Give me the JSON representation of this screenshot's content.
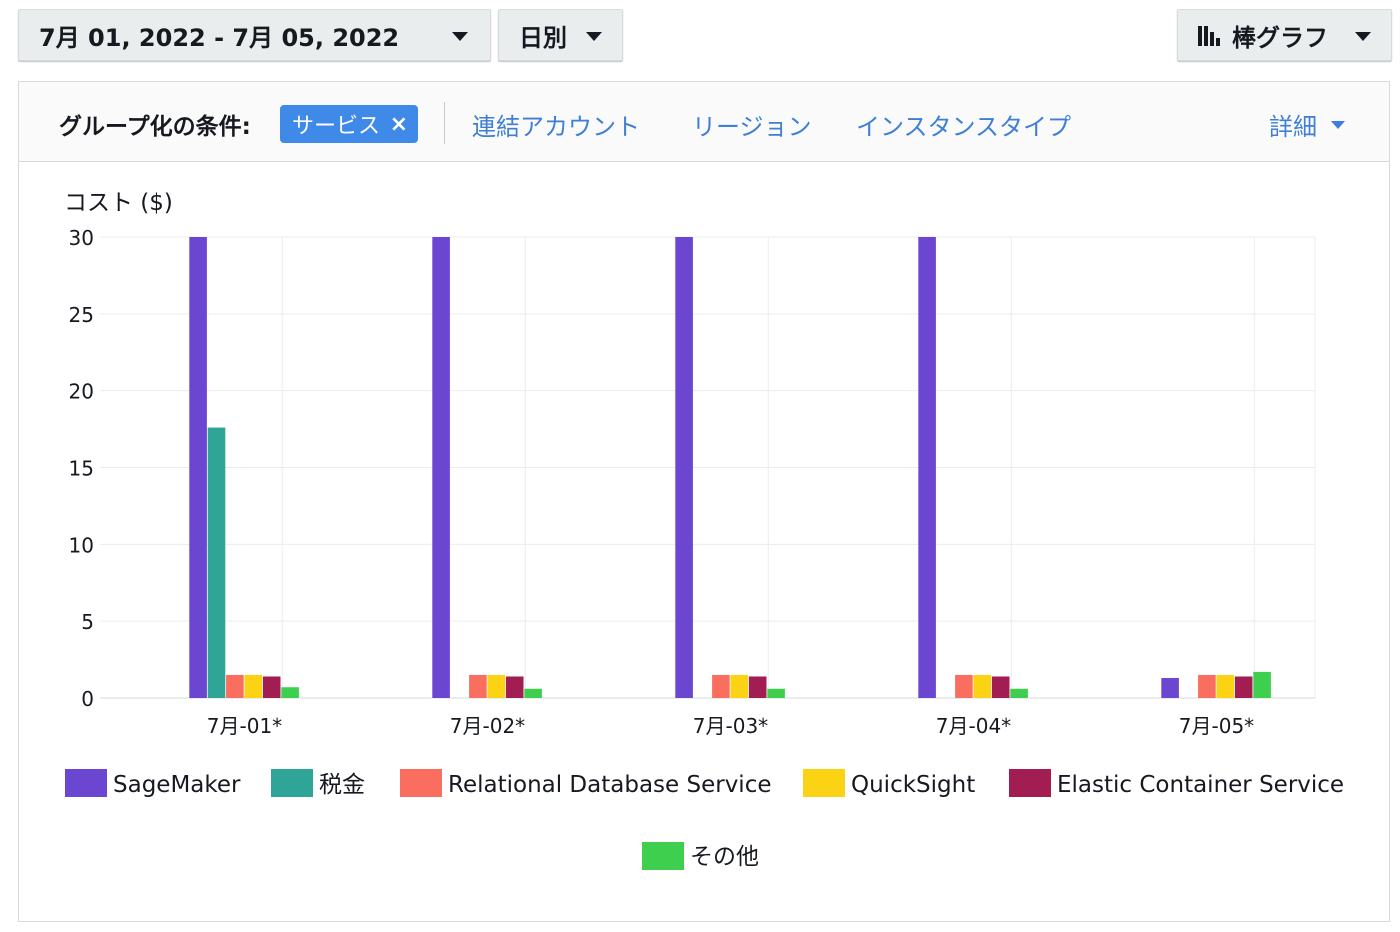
{
  "toolbar": {
    "date_range": "7月 01, 2022 - 7月 05, 2022",
    "granularity": "日別",
    "chart_type": "棒グラフ"
  },
  "groupby": {
    "label": "グループ化の条件:",
    "chip": "サービス",
    "chip_remove": "×",
    "links": [
      "連結アカウント",
      "リージョン",
      "インスタンスタイプ"
    ],
    "more": "詳細"
  },
  "chart_data": {
    "type": "bar",
    "ylabel": "コスト ($)",
    "ylim": [
      0,
      30
    ],
    "yticks": [
      0,
      5,
      10,
      15,
      20,
      25,
      30
    ],
    "categories": [
      "7月-01*",
      "7月-02*",
      "7月-03*",
      "7月-04*",
      "7月-05*"
    ],
    "grid": true,
    "legend_position": "bottom",
    "series": [
      {
        "name": "SageMaker",
        "color": "#6b46d1",
        "values": [
          30,
          30,
          30,
          30,
          1.3
        ]
      },
      {
        "name": "税金",
        "color": "#2ea597",
        "values": [
          17.6,
          0,
          0,
          0,
          0
        ]
      },
      {
        "name": "Relational Database Service",
        "color": "#fa6e5f",
        "values": [
          1.5,
          1.5,
          1.5,
          1.5,
          1.5
        ]
      },
      {
        "name": "QuickSight",
        "color": "#fcd214",
        "values": [
          1.5,
          1.5,
          1.5,
          1.5,
          1.5
        ]
      },
      {
        "name": "Elastic Container Service",
        "color": "#a21d51",
        "values": [
          1.4,
          1.4,
          1.4,
          1.4,
          1.4
        ]
      },
      {
        "name": "その他",
        "color": "#3ecf4f",
        "values": [
          0.7,
          0.6,
          0.6,
          0.6,
          1.7
        ]
      }
    ]
  }
}
